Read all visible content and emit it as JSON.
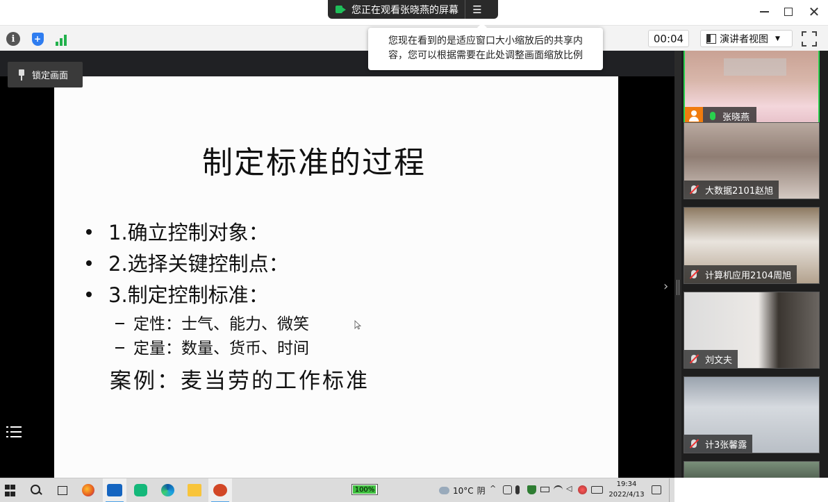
{
  "share_banner": {
    "text": "您正在观看张晓燕的屏幕",
    "menu_icon": "list-menu-icon"
  },
  "window_controls": {
    "minimize": "minimize-icon",
    "maximize": "maximize-icon",
    "close": "✕"
  },
  "toolbar": {
    "timer": "00:04",
    "presenter_view_label": "演讲者视图",
    "icons": [
      "info-icon",
      "shield-icon",
      "signal-icon",
      "fullscreen-icon"
    ]
  },
  "tooltip": {
    "line1": "您现在看到的是适应窗口大小缩放后的共享内",
    "line2": "容，您可以根据需要在此处调整画面缩放比例"
  },
  "lock_screen_label": "锁定画面",
  "slide": {
    "title": "制定标准的过程",
    "bullets": [
      "1.确立控制对象：",
      "2.选择关键控制点：",
      "3.制定控制标准："
    ],
    "sub_bullets": [
      "定性：士气、能力、微笑",
      "定量：数量、货币、时间"
    ],
    "case": "案例：麦当劳的工作标准"
  },
  "participants": [
    {
      "name": "张晓燕",
      "mic": "live",
      "active": true
    },
    {
      "name": "大数据2101赵旭",
      "mic": "muted",
      "active": false
    },
    {
      "name": "计算机应用2104周旭",
      "mic": "muted",
      "active": false
    },
    {
      "name": "刘文夫",
      "mic": "muted",
      "active": false
    },
    {
      "name": "计3张馨露",
      "mic": "muted",
      "active": false
    }
  ],
  "taskbar": {
    "battery": "100%",
    "weather_temp": "10°C",
    "weather_desc": "阴",
    "time": "19:34",
    "date": "2022/4/13"
  },
  "colors": {
    "accent_green": "#29d14e",
    "banner_bg": "#2a2a2a",
    "toolbar_bg": "#f3f3f3",
    "avatar_orange": "#f07c0f",
    "muted_red": "#e33333"
  }
}
